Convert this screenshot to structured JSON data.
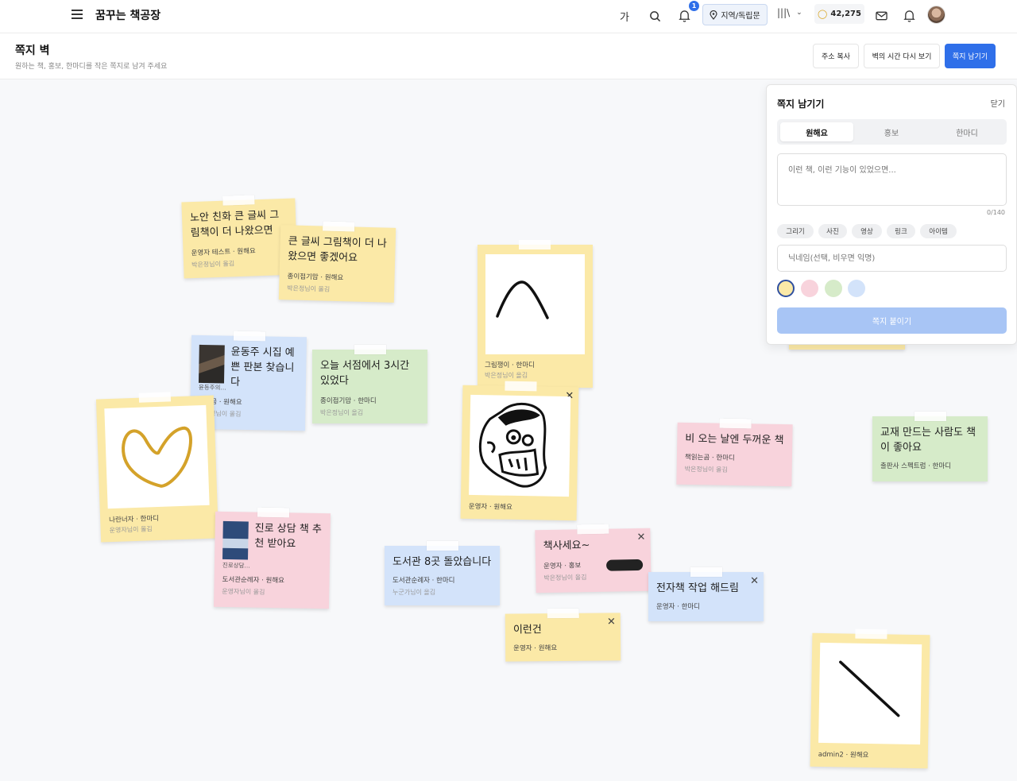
{
  "nav": {
    "brand": "꿈꾸는 책공장",
    "font_size_label": "가",
    "notification_count": "1",
    "region_label": "지역/독립문",
    "library_label": "|||\\",
    "points": "42,275"
  },
  "header": {
    "title": "쪽지 벽",
    "subtitle": "원하는 책, 홍보, 한마디를 작은 쪽지로 남겨 주세요",
    "copy_address": "주소 복사",
    "replay": "벽의 시간 다시 보기",
    "leave_note": "쪽지 남기기"
  },
  "panel": {
    "title": "쪽지 남기기",
    "close": "닫기",
    "tabs": [
      "원해요",
      "홍보",
      "한마디"
    ],
    "textarea_placeholder": "이런 책, 이런 기능이 있었으면...",
    "counter": "0/140",
    "chips": [
      "그리기",
      "사진",
      "영상",
      "링크",
      "아이템"
    ],
    "nickname_placeholder": "닉네임(선택, 비우면 익명)",
    "colors": [
      "#fbe9a7",
      "#f8d3dc",
      "#d6ebc9",
      "#d3e3fa"
    ],
    "submit": "쪽지 붙이기"
  },
  "notes": [
    {
      "text": "노안 친화 큰 글씨 그림책이 더 나왔으면",
      "meta": "운영자 테스트 · 원해요",
      "by": "박은정님이 올김"
    },
    {
      "text": "큰 글씨 그림책이 더 나왔으면 좋겠어요",
      "meta": "종이접기맘 · 원해요",
      "by": "박은정님이 올김"
    },
    {
      "text": "윤동주 시집 예쁜 판본 찾습니다",
      "cover_caption": "윤동주의...",
      "meta": "노는곰 · 원해요",
      "by": "박은정님이 올김"
    },
    {
      "text": "오늘 서점에서 3시간 있었다",
      "meta": "종이접기맘 · 한마디",
      "by": "박은정님이 올김"
    },
    {
      "text": "비 오는 날엔 두꺼운 책",
      "meta": "책읽는곰 · 한마디",
      "by": "박은정님이 올김"
    },
    {
      "text": "교재 만드는 사람도 책이 좋아요",
      "meta": "출판사 스펙트럼 · 한마디"
    },
    {
      "text": "진로 상담 책 추천 받아요",
      "cover_caption": "진로상담...",
      "meta": "도서관순례자 · 원해요",
      "by": "운영자님이 올김"
    },
    {
      "text": "도서관 8곳 돌았습니다",
      "meta": "도서관순례자 · 한마디",
      "by": "누군가님이 올김"
    },
    {
      "text": "책사세요~",
      "meta": "운영자 · 홍보",
      "by": "박은정님이 올김"
    },
    {
      "text": "전자책 작업 해드림",
      "meta": "운영자 · 한마디"
    },
    {
      "text": "이런건",
      "meta": "운영자 · 원해요"
    }
  ],
  "photos": [
    {
      "meta": "그림쟁이 · 한마디",
      "by": "박은정님이 올김"
    },
    {
      "meta": "나란너자 · 한마디",
      "by": "운영자님이 올김"
    },
    {
      "meta": "운영자 · 원해요"
    },
    {
      "meta": "admin2 · 원해요"
    }
  ]
}
